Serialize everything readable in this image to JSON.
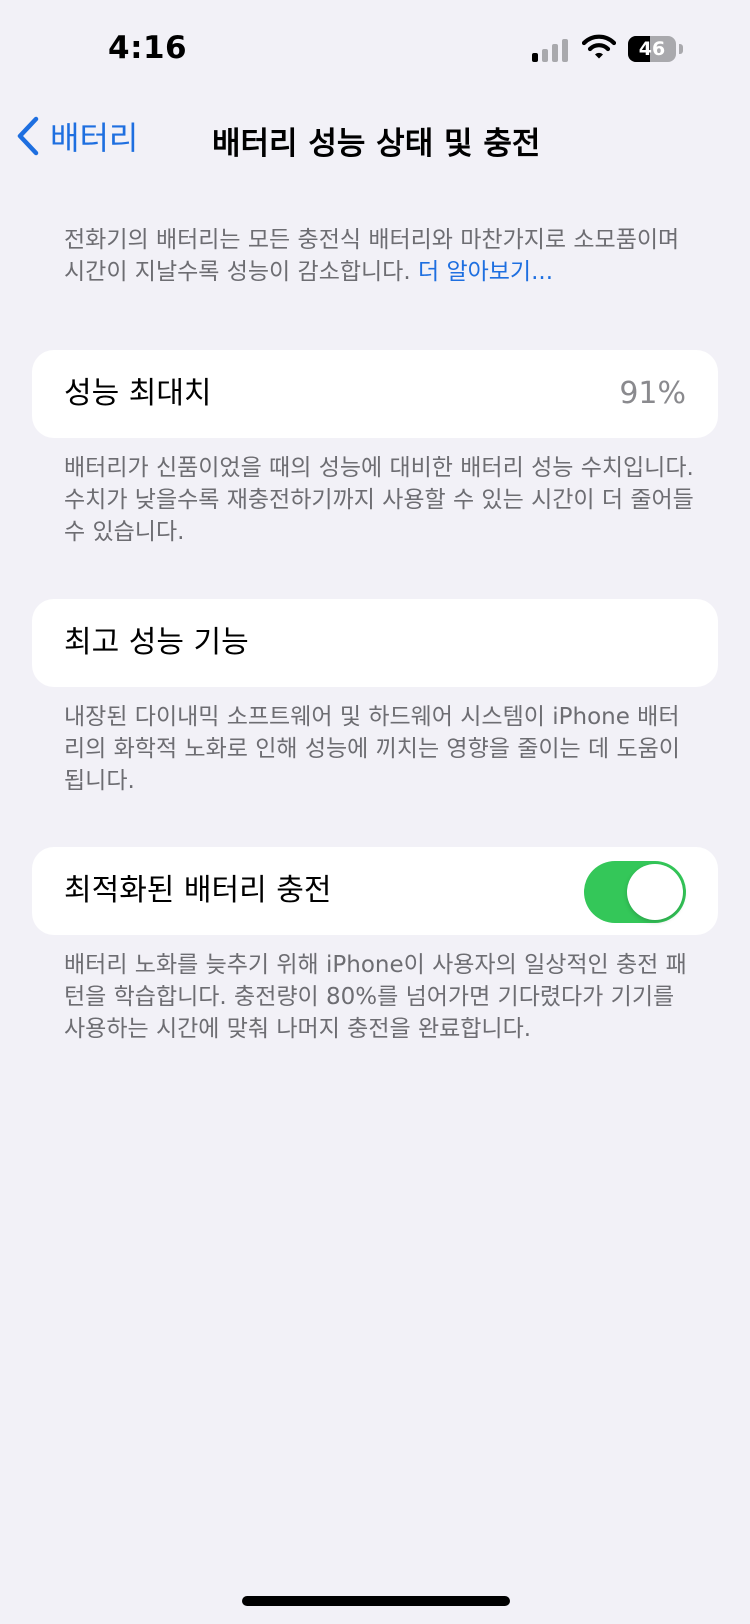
{
  "status_bar": {
    "time": "4:16",
    "battery_level": "46",
    "battery_fraction": 0.46,
    "signal_bars_active": 1,
    "signal_bars_total": 4
  },
  "nav": {
    "back_label": "배터리",
    "title": "배터리 성능 상태 및 충전"
  },
  "intro": {
    "text": "전화기의 배터리는 모든 충전식 배터리와 마찬가지로 소모품이며 시간이 지날수록 성능이 감소합니다. ",
    "link": "더 알아보기..."
  },
  "max_capacity": {
    "label": "성능 최대치",
    "value": "91%",
    "footnote": "배터리가 신품이었을 때의 성능에 대비한 배터리 성능 수치입니다. 수치가 낮을수록 재충전하기까지 사용할 수 있는 시간이 더 줄어들 수 있습니다."
  },
  "peak_performance": {
    "label": "최고 성능 기능",
    "footnote": "내장된 다이내믹 소프트웨어 및 하드웨어 시스템이 iPhone 배터리의 화학적 노화로 인해 성능에 끼치는 영향을 줄이는 데 도움이 됩니다."
  },
  "optimized_charging": {
    "label": "최적화된 배터리 충전",
    "enabled": true,
    "footnote": "배터리 노화를 늦추기 위해 iPhone이 사용자의 일상적인 충전 패턴을 학습합니다. 충전량이 80%를 넘어가면 기다렸다가 기기를 사용하는 시간에 맞춰 나머지 충전을 완료합니다."
  },
  "colors": {
    "accent": "#1e6fe0",
    "toggle_on": "#34c759",
    "background": "#f2f1f7",
    "secondary_text": "#6d6d72"
  }
}
